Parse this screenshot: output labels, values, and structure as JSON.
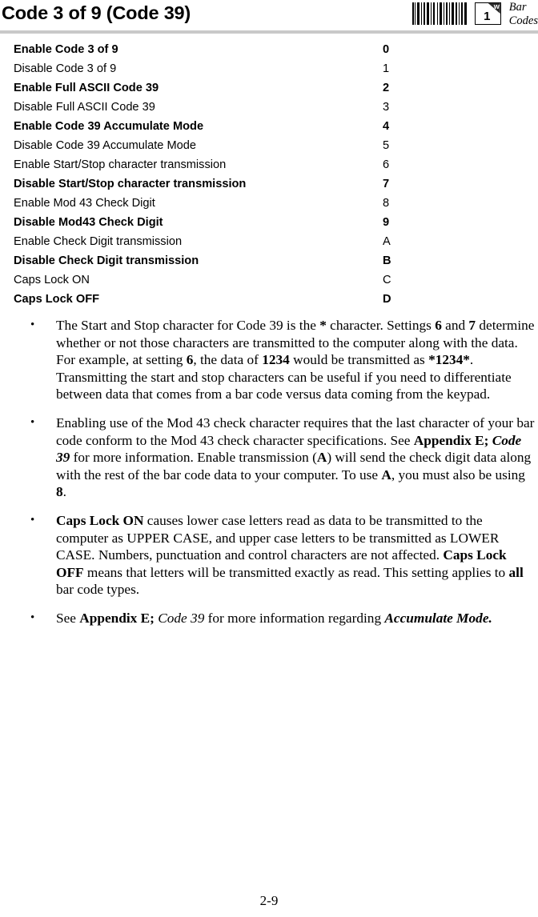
{
  "header": {
    "title": "Code 3 of 9 (Code 39)",
    "chapter_number": "1",
    "chapter_corner_letter": "w",
    "section_label_line1": "Bar",
    "section_label_line2": "Codes",
    "barcode_icon": "barcode-icon",
    "rule_color": "#c9c9c9"
  },
  "settings_table": {
    "rows": [
      {
        "label": "Enable Code 3 of 9",
        "code": "0",
        "bold": true
      },
      {
        "label": "Disable Code 3 of 9",
        "code": "1",
        "bold": false
      },
      {
        "label": "Enable Full ASCII Code 39",
        "code": "2",
        "bold": true
      },
      {
        "label": "Disable Full ASCII Code 39",
        "code": "3",
        "bold": false
      },
      {
        "label": "Enable Code 39 Accumulate Mode",
        "code": "4",
        "bold": true
      },
      {
        "label": "Disable Code 39 Accumulate Mode",
        "code": "5",
        "bold": false
      },
      {
        "label": "Enable Start/Stop character transmission",
        "code": "6",
        "bold": false
      },
      {
        "label": "Disable Start/Stop character transmission",
        "code": "7",
        "bold": true
      },
      {
        "label": "Enable Mod 43 Check Digit",
        "code": "8",
        "bold": false
      },
      {
        "label": "Disable Mod43 Check Digit",
        "code": "9",
        "bold": true
      },
      {
        "label": "Enable Check Digit transmission",
        "code": "A",
        "bold": false
      },
      {
        "label": "Disable Check Digit transmission",
        "code": "B",
        "bold": true
      },
      {
        "label": "Caps Lock ON",
        "code": "C",
        "bold": false
      },
      {
        "label": "Caps Lock OFF",
        "code": "D",
        "bold": true
      }
    ]
  },
  "bullets": [
    {
      "marker": "•",
      "runs": [
        {
          "text": "The Start and Stop character for Code 39 is the ",
          "style": "normal"
        },
        {
          "text": "*",
          "style": "bold"
        },
        {
          "text": " character.  Settings ",
          "style": "normal"
        },
        {
          "text": "6",
          "style": "bold"
        },
        {
          "text": " and ",
          "style": "normal"
        },
        {
          "text": "7",
          "style": "bold"
        },
        {
          "text": " determine whether or not those characters are transmitted to the computer along with the data.  For example, at setting ",
          "style": "normal"
        },
        {
          "text": "6",
          "style": "bold"
        },
        {
          "text": ", the data of ",
          "style": "normal"
        },
        {
          "text": "1234",
          "style": "bold"
        },
        {
          "text": " would be transmitted as ",
          "style": "normal"
        },
        {
          "text": "*1234*",
          "style": "bold"
        },
        {
          "text": ".  Transmitting the start and stop characters can be useful if you need to differentiate between data that comes from a bar code versus data coming from the keypad.",
          "style": "normal"
        }
      ]
    },
    {
      "marker": "•",
      "runs": [
        {
          "text": "Enabling use of the Mod 43 check character requires that the last character of your bar code conform to the Mod 43 check character specifications.  See ",
          "style": "normal"
        },
        {
          "text": "Appendix E;",
          "style": "bold"
        },
        {
          "text": " ",
          "style": "normal"
        },
        {
          "text": "Code 39",
          "style": "bold-italic"
        },
        {
          "text": " for more information.   Enable transmission (",
          "style": "normal"
        },
        {
          "text": "A",
          "style": "bold"
        },
        {
          "text": ") will send the check digit data along with the rest of the bar code data to your computer.  To use ",
          "style": "normal"
        },
        {
          "text": "A",
          "style": "bold"
        },
        {
          "text": ", you must also be using ",
          "style": "normal"
        },
        {
          "text": "8",
          "style": "bold"
        },
        {
          "text": ".",
          "style": "normal"
        }
      ]
    },
    {
      "marker": "•",
      "runs": [
        {
          "text": "Caps Lock ON",
          "style": "bold"
        },
        {
          "text": " causes lower case letters read as data to be transmitted to the computer as UPPER CASE, and upper case letters to be transmitted as LOWER CASE.  Numbers, punctuation and control characters are not affected.  ",
          "style": "normal"
        },
        {
          "text": "Caps Lock OFF",
          "style": "bold"
        },
        {
          "text": " means that letters will be transmitted exactly as read. This setting applies to ",
          "style": "normal"
        },
        {
          "text": "all",
          "style": "bold"
        },
        {
          "text": " bar code types.",
          "style": "normal"
        }
      ]
    },
    {
      "marker": "•",
      "runs": [
        {
          "text": "See ",
          "style": "normal"
        },
        {
          "text": "Appendix E;",
          "style": "bold"
        },
        {
          "text": " ",
          "style": "normal"
        },
        {
          "text": "Code 39",
          "style": "italic"
        },
        {
          "text": " for more information regarding ",
          "style": "normal"
        },
        {
          "text": "Accumulate Mode.",
          "style": "bold-italic"
        }
      ]
    }
  ],
  "footer": {
    "page_number": "2-9"
  }
}
